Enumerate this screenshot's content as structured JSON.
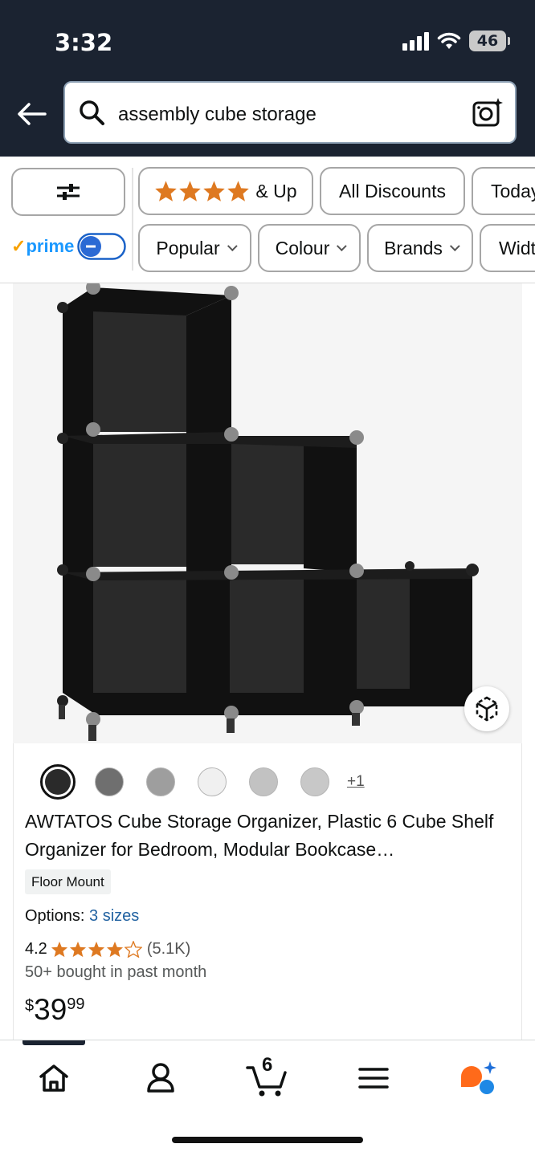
{
  "status_bar": {
    "time": "3:32",
    "battery": "46",
    "icons": [
      "signal-icon",
      "wifi-icon",
      "battery-icon"
    ]
  },
  "header": {
    "back_icon": "back-arrow-icon",
    "search_query": "assembly cube storage",
    "camera_icon": "camera-search-icon"
  },
  "filters": {
    "row1": [
      "& Up",
      "All Discounts",
      "Today"
    ],
    "row2": [
      "Popular",
      "Colour",
      "Brands",
      "Widt"
    ],
    "prime_label": "prime",
    "prime_toggle": "off"
  },
  "product": {
    "more_colors": "+1",
    "title": "AWTATOS Cube Storage Organizer, Plastic 6 Cube Shelf Organizer for Bedroom, Modular Bookcase…",
    "badge": "Floor Mount",
    "options_label": "Options:",
    "options_value": "3 sizes",
    "rating": "4.2",
    "rating_count": "(5.1K)",
    "bought": "50+ bought in past month",
    "price_symbol": "$",
    "price_whole": "39",
    "price_fraction": "99"
  },
  "bottom_nav": {
    "cart_count": "6",
    "items": [
      "home-icon",
      "account-icon",
      "cart-icon",
      "menu-icon",
      "rufus-icon"
    ]
  },
  "colors": {
    "header_bg": "#1b2331",
    "accent_star": "#de7921",
    "link": "#2162a1",
    "prime": "#1a98ff"
  }
}
